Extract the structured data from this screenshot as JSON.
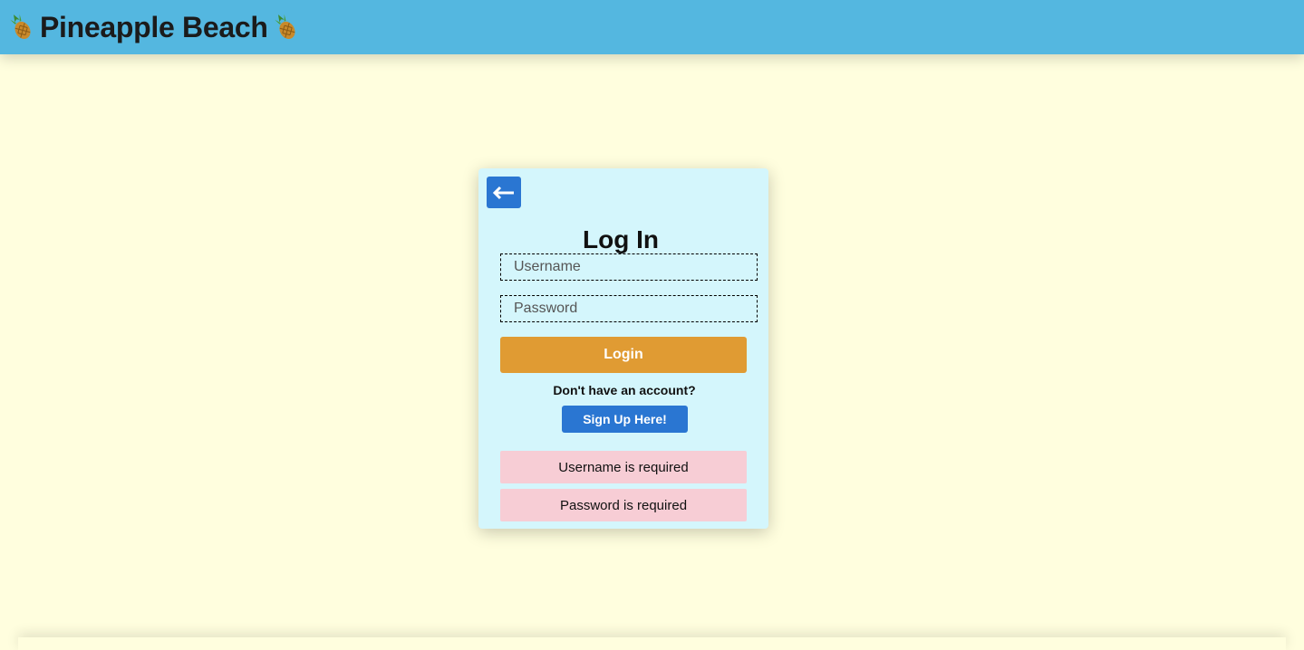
{
  "header": {
    "title": "Pineapple Beach",
    "left_icon": "pineapple-icon",
    "right_icon": "pineapple-icon",
    "background_color": "#54b7e0"
  },
  "page": {
    "background_color": "#fffede"
  },
  "login_card": {
    "back_icon": "arrow-left-icon",
    "title": "Log In",
    "username_placeholder": "Username",
    "password_placeholder": "Password",
    "login_label": "Login",
    "no_account_text": "Don't have an account?",
    "signup_label": "Sign Up Here!",
    "errors": [
      "Username is required",
      "Password is required"
    ],
    "colors": {
      "card_background": "#d4f6fc",
      "login_button": "#e09b33",
      "signup_button": "#2a76d2",
      "back_button": "#2a76d2",
      "error_background": "#f7cdd5"
    }
  }
}
